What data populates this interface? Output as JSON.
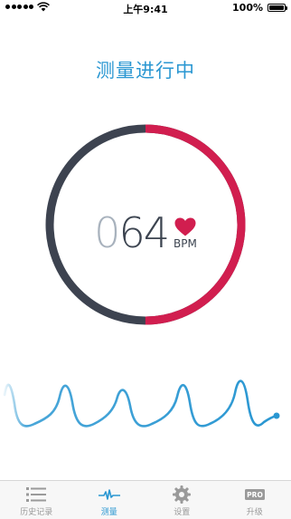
{
  "status_bar": {
    "time": "上午9:41",
    "battery": "100%"
  },
  "title": "测量进行中",
  "reading": {
    "bpm_lead": "0",
    "bpm_main": "64",
    "unit": "BPM"
  },
  "progress": {
    "measured_fraction": 0.5
  },
  "colors": {
    "accent": "#2a97d2",
    "heart": "#d11e4f",
    "ring_done": "#d11e4f",
    "ring_remaining": "#3d4350",
    "waveform": "#2a97d2"
  },
  "tabs": [
    {
      "label": "历史记录",
      "icon": "list-icon",
      "active": false
    },
    {
      "label": "测量",
      "icon": "pulse-icon",
      "active": true
    },
    {
      "label": "设置",
      "icon": "gear-icon",
      "active": false
    },
    {
      "label": "升级",
      "icon": "pro-badge-icon",
      "badge": "PRO",
      "active": false
    }
  ]
}
